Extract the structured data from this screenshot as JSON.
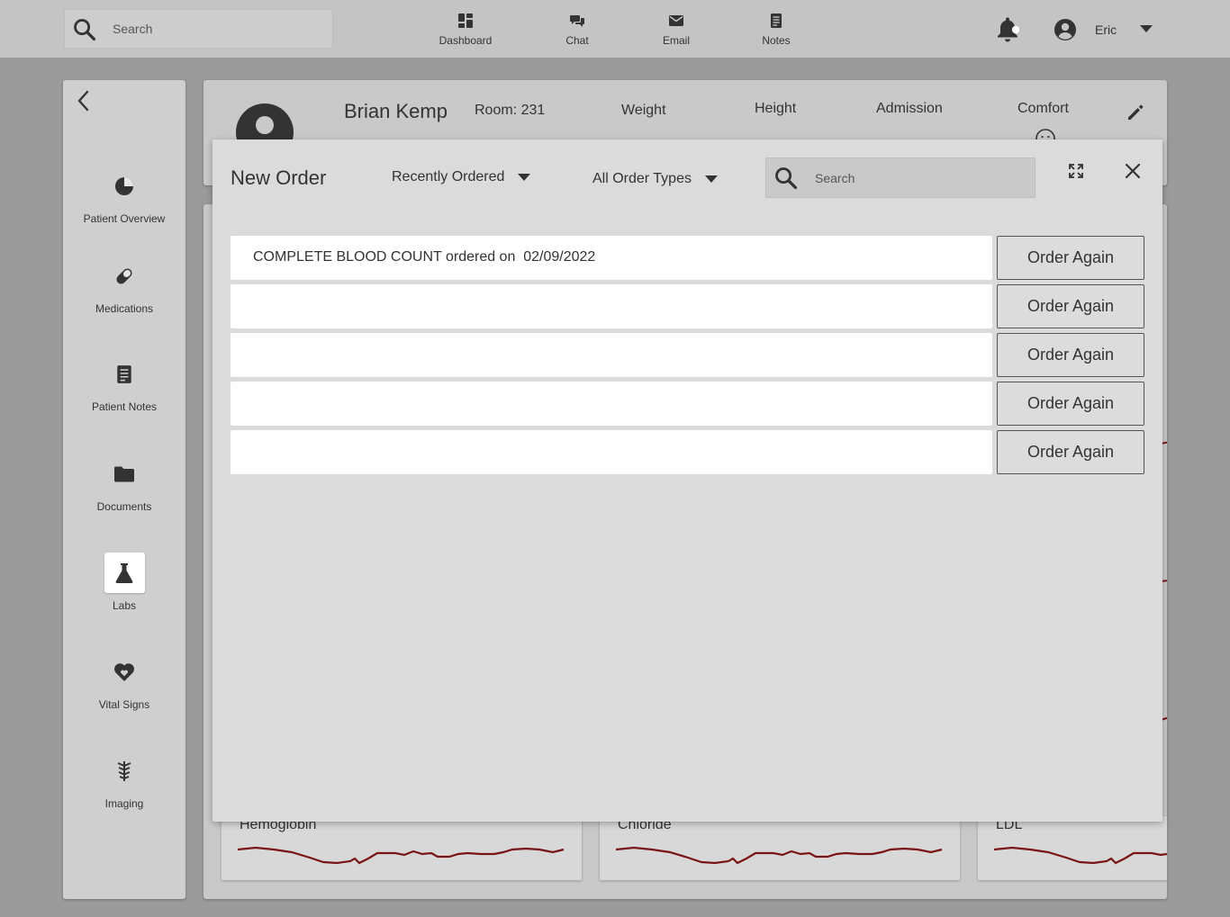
{
  "topbar": {
    "search_placeholder": "Search",
    "nav": [
      {
        "label": "Dashboard",
        "icon": "dashboard-icon"
      },
      {
        "label": "Chat",
        "icon": "chat-icon"
      },
      {
        "label": "Email",
        "icon": "email-icon"
      },
      {
        "label": "Notes",
        "icon": "notes-icon"
      }
    ],
    "user_name": "Eric"
  },
  "sidebar": {
    "items": [
      {
        "label": "Patient Overview",
        "icon": "pie-chart-icon",
        "active": false
      },
      {
        "label": "Medications",
        "icon": "pill-icon",
        "active": false
      },
      {
        "label": "Patient Notes",
        "icon": "notes-icon",
        "active": false
      },
      {
        "label": "Documents",
        "icon": "folder-icon",
        "active": false
      },
      {
        "label": "Labs",
        "icon": "flask-icon",
        "active": true
      },
      {
        "label": "Vital Signs",
        "icon": "heart-icon",
        "active": false
      },
      {
        "label": "Imaging",
        "icon": "spine-icon",
        "active": false
      }
    ]
  },
  "patient": {
    "name": "Brian Kemp",
    "room": "Room: 231",
    "stats": [
      {
        "label": "Weight"
      },
      {
        "label": "Height"
      },
      {
        "label": "Admission"
      },
      {
        "label": "Comfort"
      }
    ]
  },
  "lab_cards": [
    {
      "title": "Hemoglobin"
    },
    {
      "title": "Chloride"
    },
    {
      "title": "LDL"
    }
  ],
  "modal": {
    "title": "New Order",
    "filter_recent": "Recently Ordered",
    "filter_types": "All Order Types",
    "search_placeholder": "Search",
    "orders": [
      {
        "text": "COMPLETE BLOOD COUNT ordered on  02/09/2022",
        "button": "Order Again"
      },
      {
        "text": "",
        "button": "Order Again"
      },
      {
        "text": "",
        "button": "Order Again"
      },
      {
        "text": "",
        "button": "Order Again"
      },
      {
        "text": "",
        "button": "Order Again"
      }
    ]
  },
  "colors": {
    "trend_line": "#7a1414",
    "topbar_bg": "#c4c4c4",
    "modal_bg": "#dbdbdb",
    "page_bg": "#9b9b9b"
  }
}
